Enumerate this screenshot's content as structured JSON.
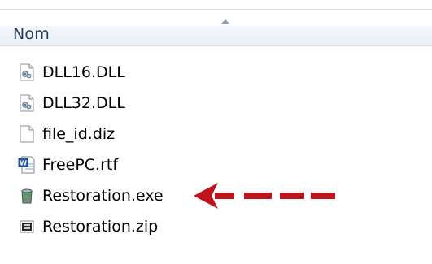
{
  "header": {
    "column_name": "Nom"
  },
  "files": [
    {
      "name": "DLL16.DLL",
      "icon": "dll-file-icon"
    },
    {
      "name": "DLL32.DLL",
      "icon": "dll-file-icon"
    },
    {
      "name": "file_id.diz",
      "icon": "blank-file-icon"
    },
    {
      "name": "FreePC.rtf",
      "icon": "word-document-icon"
    },
    {
      "name": "Restoration.exe",
      "icon": "executable-icon"
    },
    {
      "name": "Restoration.zip",
      "icon": "zip-archive-icon"
    }
  ],
  "annotation": {
    "icon": "red-dashed-arrow-icon",
    "color": "#c0141c",
    "points_to": "Restoration.exe"
  },
  "colors": {
    "header_text": "#1e395b",
    "header_border": "#d5dde8",
    "arrow": "#c0141c"
  }
}
